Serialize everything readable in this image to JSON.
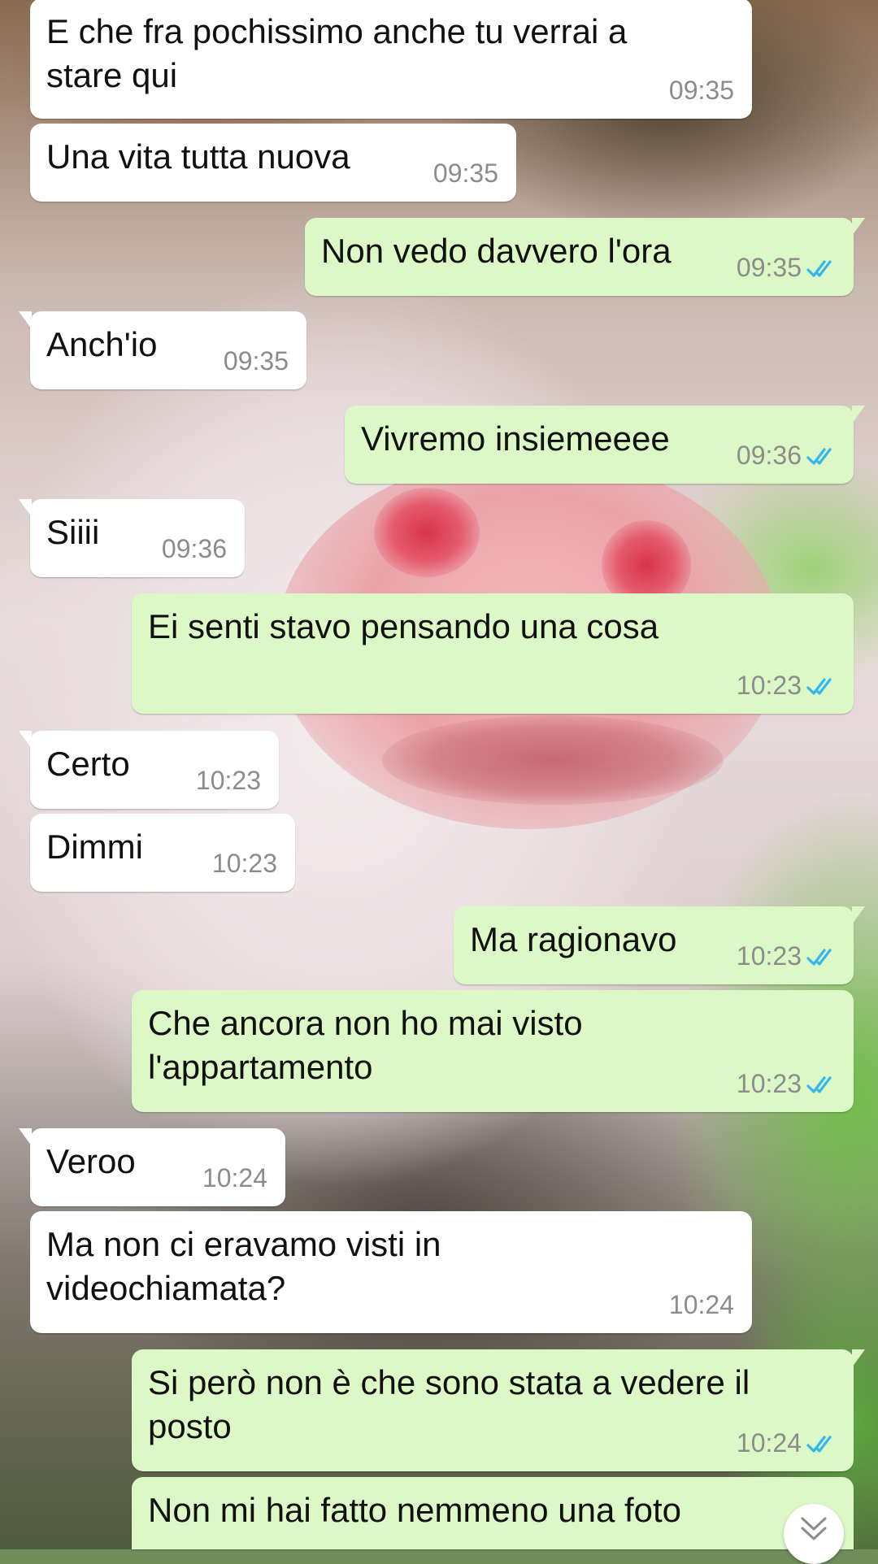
{
  "messages": [
    {
      "dir": "in",
      "text": "E che fra pochissimo anche tu verrai a stare qui",
      "time": "09:35"
    },
    {
      "dir": "in",
      "text": "Una vita tutta nuova",
      "time": "09:35"
    },
    {
      "dir": "out",
      "text": "Non vedo davvero l'ora",
      "time": "09:35",
      "status": "read"
    },
    {
      "dir": "in",
      "text": "Anch'io",
      "time": "09:35"
    },
    {
      "dir": "out",
      "text": "Vivremo insiemeeee",
      "time": "09:36",
      "status": "read"
    },
    {
      "dir": "in",
      "text": "Siiii",
      "time": "09:36"
    },
    {
      "dir": "out",
      "text": "Ei senti stavo pensando una cosa",
      "time": "10:23",
      "status": "read"
    },
    {
      "dir": "in",
      "text": "Certo",
      "time": "10:23"
    },
    {
      "dir": "in",
      "text": "Dimmi",
      "time": "10:23"
    },
    {
      "dir": "out",
      "text": "Ma ragionavo",
      "time": "10:23",
      "status": "read"
    },
    {
      "dir": "out",
      "text": "Che ancora non ho mai visto l'appartamento",
      "time": "10:23",
      "status": "read"
    },
    {
      "dir": "in",
      "text": "Veroo",
      "time": "10:24"
    },
    {
      "dir": "in",
      "text": "Ma non ci eravamo visti in videochiamata?",
      "time": "10:24"
    },
    {
      "dir": "out",
      "text": "Si però non è che sono stata a vedere il posto",
      "time": "10:24",
      "status": "read"
    },
    {
      "dir": "out",
      "text": "Non mi hai fatto nemmeno una foto",
      "time": "",
      "status": ""
    }
  ],
  "colors": {
    "incoming_bubble": "#ffffff",
    "outgoing_bubble": "#dcf8c6",
    "read_ticks": "#34b7f1",
    "timestamp": "#8c8c8c"
  },
  "icons": {
    "read_receipt": "double-check-icon",
    "scroll_down": "chevron-down-icon"
  }
}
